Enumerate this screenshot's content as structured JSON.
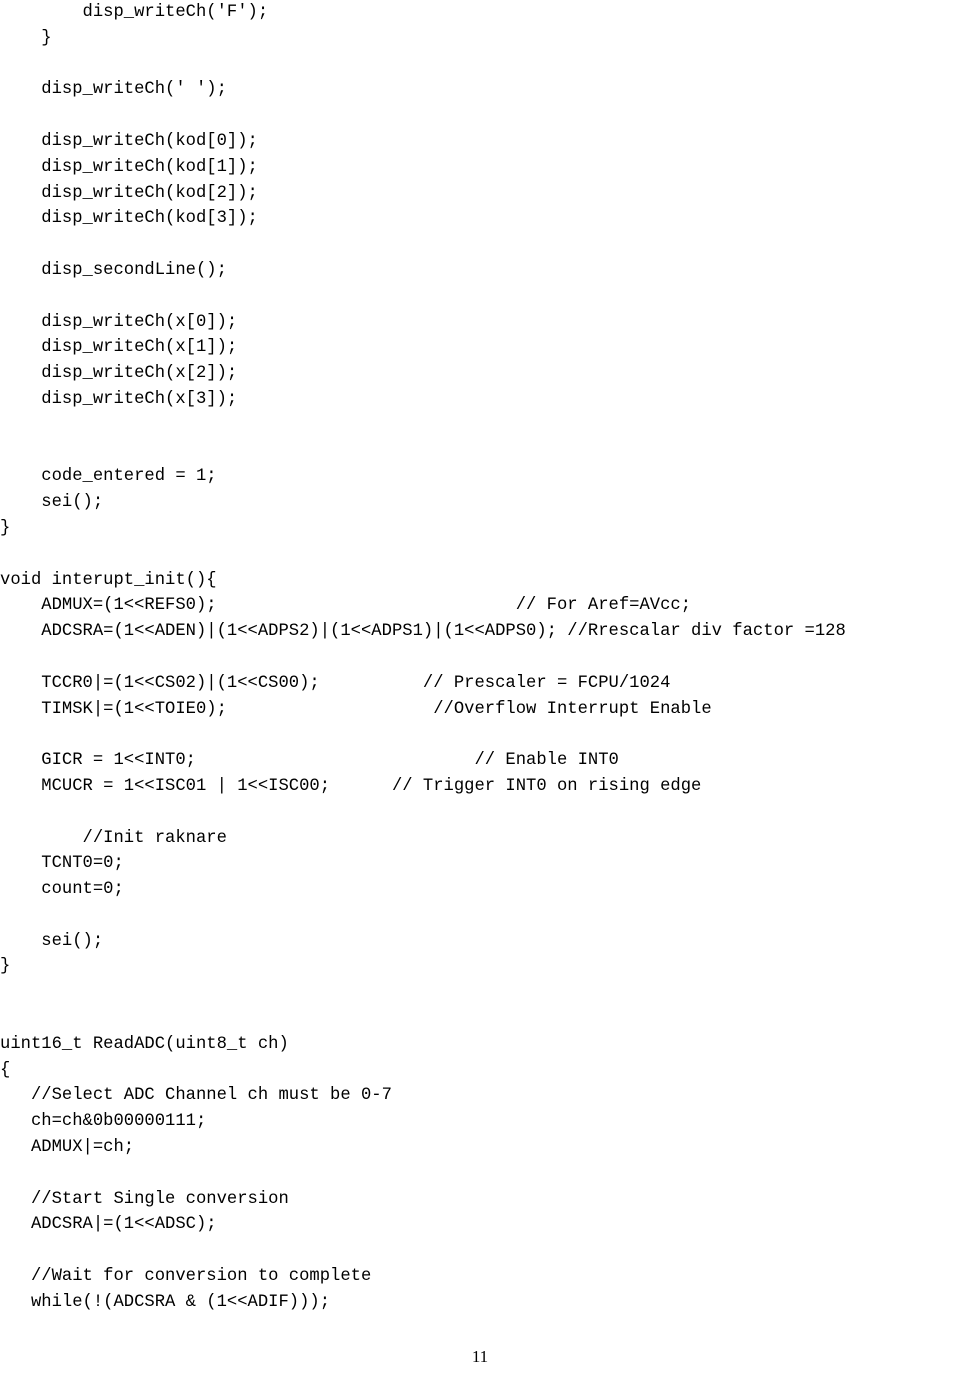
{
  "code_lines": [
    "        disp_writeCh('F');",
    "    }",
    "",
    "    disp_writeCh(' ');",
    "",
    "    disp_writeCh(kod[0]);",
    "    disp_writeCh(kod[1]);",
    "    disp_writeCh(kod[2]);",
    "    disp_writeCh(kod[3]);",
    "",
    "    disp_secondLine();",
    "",
    "    disp_writeCh(x[0]);",
    "    disp_writeCh(x[1]);",
    "    disp_writeCh(x[2]);",
    "    disp_writeCh(x[3]);",
    "",
    "",
    "    code_entered = 1;",
    "    sei();",
    "}",
    "",
    "void interupt_init(){",
    "    ADMUX=(1<<REFS0);                             // For Aref=AVcc;",
    "    ADCSRA=(1<<ADEN)|(1<<ADPS2)|(1<<ADPS1)|(1<<ADPS0); //Rrescalar div factor =128",
    "",
    "    TCCR0|=(1<<CS02)|(1<<CS00);          // Prescaler = FCPU/1024",
    "    TIMSK|=(1<<TOIE0);                    //Overflow Interrupt Enable",
    "",
    "    GICR = 1<<INT0;                           // Enable INT0",
    "    MCUCR = 1<<ISC01 | 1<<ISC00;      // Trigger INT0 on rising edge",
    "",
    "        //Init raknare",
    "    TCNT0=0;",
    "    count=0;",
    "",
    "    sei();",
    "}",
    "",
    "",
    "uint16_t ReadADC(uint8_t ch)",
    "{",
    "   //Select ADC Channel ch must be 0-7",
    "   ch=ch&0b00000111;",
    "   ADMUX|=ch;",
    "",
    "   //Start Single conversion",
    "   ADCSRA|=(1<<ADSC);",
    "",
    "   //Wait for conversion to complete",
    "   while(!(ADCSRA & (1<<ADIF)));"
  ],
  "page_number": "11"
}
